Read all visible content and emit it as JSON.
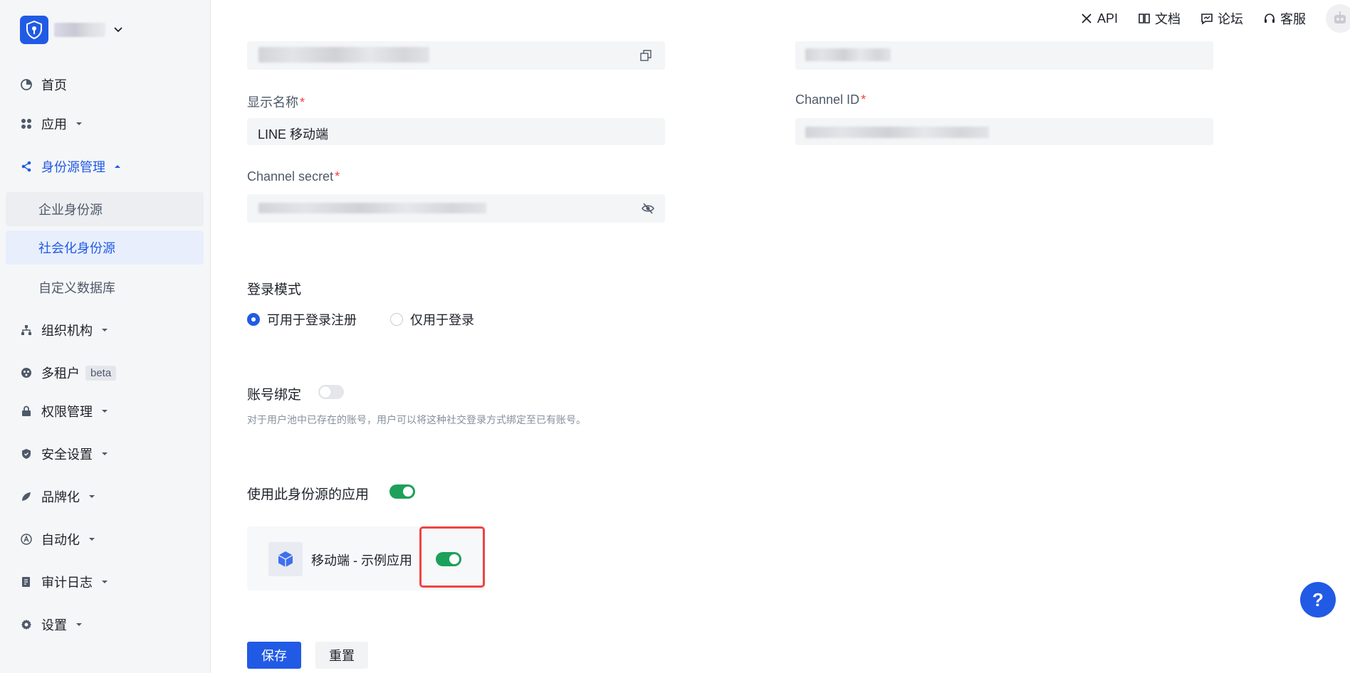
{
  "colors": {
    "accent": "#215ae5",
    "switch_on": "#1da05b",
    "required": "#f53f3f",
    "highlight": "#ef4444"
  },
  "sidebar": {
    "items": [
      {
        "label": "首页",
        "icon": "pie-chart-icon"
      },
      {
        "label": "应用",
        "icon": "apps-icon"
      },
      {
        "label": "身份源管理",
        "icon": "share-icon",
        "expanded": true,
        "children": [
          {
            "label": "企业身份源"
          },
          {
            "label": "社会化身份源",
            "selected": true
          },
          {
            "label": "自定义数据库"
          }
        ]
      },
      {
        "label": "组织机构",
        "icon": "org-icon"
      },
      {
        "label": "多租户",
        "icon": "tenant-icon",
        "tag": "beta"
      },
      {
        "label": "权限管理",
        "icon": "lock-icon"
      },
      {
        "label": "安全设置",
        "icon": "shield-icon"
      },
      {
        "label": "品牌化",
        "icon": "brand-icon"
      },
      {
        "label": "自动化",
        "icon": "automation-icon"
      },
      {
        "label": "审计日志",
        "icon": "log-icon"
      },
      {
        "label": "设置",
        "icon": "gear-icon"
      }
    ]
  },
  "topbar": {
    "links": [
      {
        "label": "API",
        "icon": "tools-icon"
      },
      {
        "label": "文档",
        "icon": "book-icon"
      },
      {
        "label": "论坛",
        "icon": "forum-icon"
      },
      {
        "label": "客服",
        "icon": "headset-icon"
      }
    ]
  },
  "form": {
    "display_name": {
      "label": "显示名称",
      "value": "LINE 移动端",
      "required_mark": "*"
    },
    "channel_id": {
      "label": "Channel ID",
      "required_mark": "*"
    },
    "channel_secret": {
      "label": "Channel secret",
      "required_mark": "*"
    },
    "login_mode": {
      "title": "登录模式",
      "options": [
        {
          "label": "可用于登录注册",
          "checked": true
        },
        {
          "label": "仅用于登录",
          "checked": false
        }
      ]
    },
    "account_binding": {
      "title": "账号绑定",
      "enabled": false,
      "hint": "对于用户池中已存在的账号，用户可以将这种社交登录方式绑定至已有账号。"
    },
    "apps_using": {
      "title": "使用此身份源的应用",
      "enabled": true,
      "apps": [
        {
          "name": "移动端 - 示例应用",
          "enabled": true
        }
      ]
    }
  },
  "actions": {
    "save_label": "保存",
    "reset_label": "重置"
  },
  "help": {
    "label": "?"
  }
}
